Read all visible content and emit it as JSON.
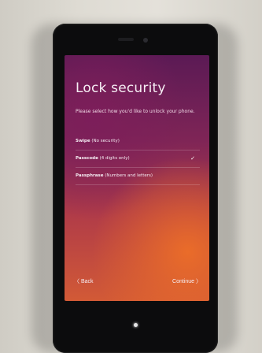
{
  "screen": {
    "title": "Lock security",
    "description": "Please select how you'd like to unlock your phone.",
    "options": [
      {
        "name": "Swipe",
        "detail": "(No security)"
      },
      {
        "name": "Passcode",
        "detail": "(4 digits only)"
      },
      {
        "name": "Passphrase",
        "detail": "(Numbers and letters)"
      }
    ],
    "selected_check": "✓",
    "back_label": "〈 Back",
    "continue_label": "Continue 〉"
  },
  "colors": {
    "wallpaper_top": "#5b1a55",
    "wallpaper_bottom": "#d25a36"
  }
}
